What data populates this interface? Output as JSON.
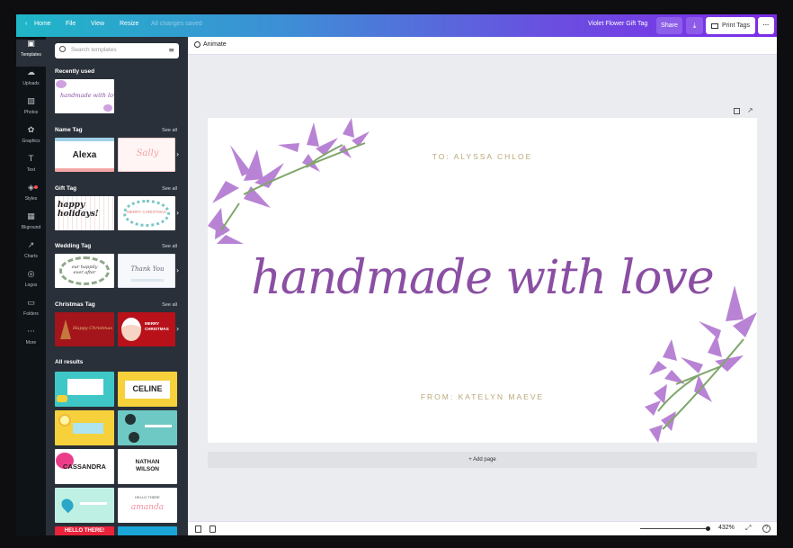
{
  "topbar": {
    "home": "Home",
    "file": "File",
    "view": "View",
    "resize": "Resize",
    "saved": "All changes saved",
    "title": "Violet Flower Gift Tag",
    "share": "Share",
    "print": "Print Tags",
    "more": "···"
  },
  "rail": [
    {
      "label": "Templates",
      "icon": "▣"
    },
    {
      "label": "Uploads",
      "icon": "☁"
    },
    {
      "label": "Photos",
      "icon": "▨"
    },
    {
      "label": "Graphics",
      "icon": "✿"
    },
    {
      "label": "Text",
      "icon": "T"
    },
    {
      "label": "Styles",
      "icon": "◈"
    },
    {
      "label": "Bkground",
      "icon": "▦"
    },
    {
      "label": "Charts",
      "icon": "↗"
    },
    {
      "label": "Logos",
      "icon": "◎"
    },
    {
      "label": "Folders",
      "icon": "▭"
    },
    {
      "label": "More",
      "icon": "···"
    }
  ],
  "panel": {
    "search_placeholder": "Search templates",
    "see_all": "See all",
    "recently_used": "Recently used",
    "name_tag": "Name Tag",
    "gift_tag": "Gift Tag",
    "wedding_tag": "Wedding Tag",
    "christmas_tag": "Christmas Tag",
    "all_results": "All results",
    "thumbs": {
      "recent": "handmade with love",
      "name1": "Alexa",
      "name2": "Sally",
      "gift1": "happy holidays!",
      "gift2": "MERRY CHRISTMAS",
      "wed1": "our happily ever after",
      "wed2": "Thank You",
      "xmas1": "Happy Christmas",
      "xmas2": "MERRY CHRISTMAS",
      "r1b": "CELINE",
      "r3a": "CASSANDRA",
      "r3b": "NATHAN WILSON",
      "r4b": "amanda",
      "r4b_small": "HELLO THERE",
      "r5a": "HELLO THERE!"
    }
  },
  "toolbar": {
    "animate": "Animate"
  },
  "canvas": {
    "to": "TO: ALYSSA CHLOE",
    "headline": "handmade with love",
    "from": "FROM: KATELYN MAEVE"
  },
  "add_page": "+ Add page",
  "zoom": "432%",
  "colors": {
    "accent": "#7d2ae8",
    "headline": "#8a4fa3",
    "gold": "#b7a878",
    "flower": "#a561c9"
  }
}
